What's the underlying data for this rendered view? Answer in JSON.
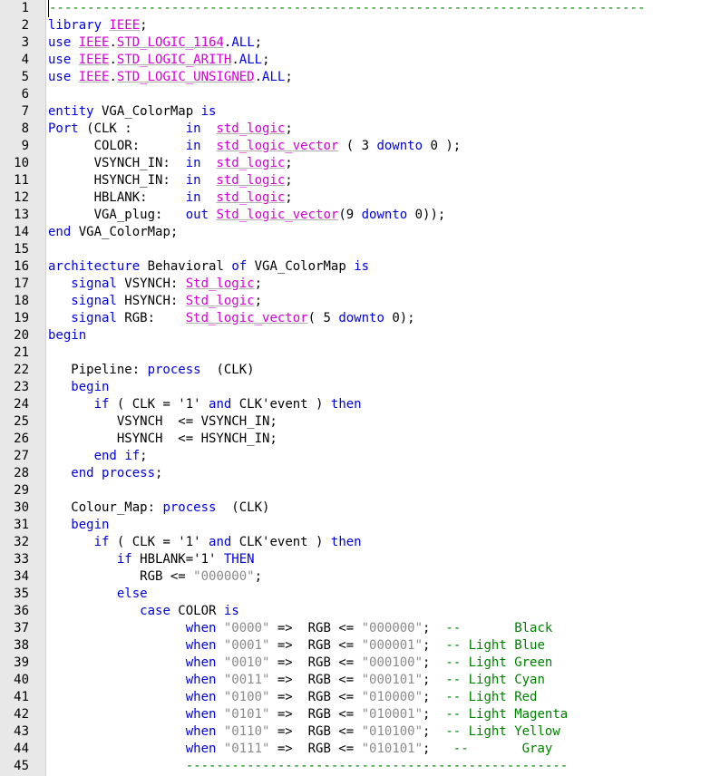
{
  "editor": {
    "colors": {
      "keyword": "#0000e6",
      "type": "#d400d4",
      "string": "#8a8a8a",
      "comment": "#008000",
      "gutter": "#e8e8e8"
    },
    "lines": [
      {
        "n": "1",
        "t": [
          [
            "cm",
            "------------------------------------------------------------------------------"
          ]
        ]
      },
      {
        "n": "2",
        "t": [
          [
            "kw",
            "library"
          ],
          [
            "id",
            " "
          ],
          [
            "typ",
            "IEEE"
          ],
          [
            "op",
            ";"
          ]
        ]
      },
      {
        "n": "3",
        "t": [
          [
            "kw",
            "use"
          ],
          [
            "id",
            " "
          ],
          [
            "typ",
            "IEEE"
          ],
          [
            "op",
            "."
          ],
          [
            "typ",
            "STD_LOGIC_1164"
          ],
          [
            "op",
            "."
          ],
          [
            "kw",
            "ALL"
          ],
          [
            "op",
            ";"
          ]
        ]
      },
      {
        "n": "4",
        "t": [
          [
            "kw",
            "use"
          ],
          [
            "id",
            " "
          ],
          [
            "typ",
            "IEEE"
          ],
          [
            "op",
            "."
          ],
          [
            "typ",
            "STD_LOGIC_ARITH"
          ],
          [
            "op",
            "."
          ],
          [
            "kw",
            "ALL"
          ],
          [
            "op",
            ";"
          ]
        ]
      },
      {
        "n": "5",
        "t": [
          [
            "kw",
            "use"
          ],
          [
            "id",
            " "
          ],
          [
            "typ",
            "IEEE"
          ],
          [
            "op",
            "."
          ],
          [
            "typ",
            "STD_LOGIC_UNSIGNED"
          ],
          [
            "op",
            "."
          ],
          [
            "kw",
            "ALL"
          ],
          [
            "op",
            ";"
          ]
        ]
      },
      {
        "n": "6",
        "t": []
      },
      {
        "n": "7",
        "t": [
          [
            "kw",
            "entity"
          ],
          [
            "id",
            " VGA_ColorMap "
          ],
          [
            "kw",
            "is"
          ]
        ]
      },
      {
        "n": "8",
        "t": [
          [
            "kw",
            "Port"
          ],
          [
            "id",
            " (CLK :       "
          ],
          [
            "kw",
            "in"
          ],
          [
            "id",
            "  "
          ],
          [
            "typ",
            "std_logic"
          ],
          [
            "op",
            ";"
          ]
        ]
      },
      {
        "n": "9",
        "t": [
          [
            "id",
            "      COLOR:      "
          ],
          [
            "kw",
            "in"
          ],
          [
            "id",
            "  "
          ],
          [
            "typ",
            "std_logic_vector"
          ],
          [
            "id",
            " ( 3 "
          ],
          [
            "kw",
            "downto"
          ],
          [
            "id",
            " 0 );"
          ]
        ]
      },
      {
        "n": "10",
        "t": [
          [
            "id",
            "      VSYNCH_IN:  "
          ],
          [
            "kw",
            "in"
          ],
          [
            "id",
            "  "
          ],
          [
            "typ",
            "std_logic"
          ],
          [
            "op",
            ";"
          ]
        ]
      },
      {
        "n": "11",
        "t": [
          [
            "id",
            "      HSYNCH_IN:  "
          ],
          [
            "kw",
            "in"
          ],
          [
            "id",
            "  "
          ],
          [
            "typ",
            "std_logic"
          ],
          [
            "op",
            ";"
          ]
        ]
      },
      {
        "n": "12",
        "t": [
          [
            "id",
            "      HBLANK:     "
          ],
          [
            "kw",
            "in"
          ],
          [
            "id",
            "  "
          ],
          [
            "typ",
            "std_logic"
          ],
          [
            "op",
            ";"
          ]
        ]
      },
      {
        "n": "13",
        "t": [
          [
            "id",
            "      VGA_plug:   "
          ],
          [
            "kw",
            "out"
          ],
          [
            "id",
            " "
          ],
          [
            "typ",
            "Std_logic_vector"
          ],
          [
            "id",
            "(9 "
          ],
          [
            "kw",
            "downto"
          ],
          [
            "id",
            " 0));"
          ]
        ]
      },
      {
        "n": "14",
        "t": [
          [
            "kw",
            "end"
          ],
          [
            "id",
            " VGA_ColorMap;"
          ]
        ]
      },
      {
        "n": "15",
        "t": []
      },
      {
        "n": "16",
        "t": [
          [
            "kw",
            "architecture"
          ],
          [
            "id",
            " Behavioral "
          ],
          [
            "kw",
            "of"
          ],
          [
            "id",
            " VGA_ColorMap "
          ],
          [
            "kw",
            "is"
          ]
        ]
      },
      {
        "n": "17",
        "t": [
          [
            "id",
            "   "
          ],
          [
            "kw",
            "signal"
          ],
          [
            "id",
            " VSYNCH: "
          ],
          [
            "typ",
            "Std_logic"
          ],
          [
            "op",
            ";"
          ]
        ]
      },
      {
        "n": "18",
        "t": [
          [
            "id",
            "   "
          ],
          [
            "kw",
            "signal"
          ],
          [
            "id",
            " HSYNCH: "
          ],
          [
            "typ",
            "Std_logic"
          ],
          [
            "op",
            ";"
          ]
        ]
      },
      {
        "n": "19",
        "t": [
          [
            "id",
            "   "
          ],
          [
            "kw",
            "signal"
          ],
          [
            "id",
            " RGB:    "
          ],
          [
            "typ",
            "Std_logic_vector"
          ],
          [
            "id",
            "( 5 "
          ],
          [
            "kw",
            "downto"
          ],
          [
            "id",
            " 0);"
          ]
        ]
      },
      {
        "n": "20",
        "t": [
          [
            "kw",
            "begin"
          ]
        ]
      },
      {
        "n": "21",
        "t": []
      },
      {
        "n": "22",
        "t": [
          [
            "id",
            "   Pipeline: "
          ],
          [
            "kw",
            "process"
          ],
          [
            "id",
            "  (CLK)"
          ]
        ]
      },
      {
        "n": "23",
        "t": [
          [
            "id",
            "   "
          ],
          [
            "kw",
            "begin"
          ]
        ]
      },
      {
        "n": "24",
        "t": [
          [
            "id",
            "      "
          ],
          [
            "kw",
            "if"
          ],
          [
            "id",
            " ( CLK = '1' "
          ],
          [
            "kw",
            "and"
          ],
          [
            "id",
            " CLK'event ) "
          ],
          [
            "kw",
            "then"
          ]
        ]
      },
      {
        "n": "25",
        "t": [
          [
            "id",
            "         VSYNCH  <= VSYNCH_IN;"
          ]
        ]
      },
      {
        "n": "26",
        "t": [
          [
            "id",
            "         HSYNCH  <= HSYNCH_IN;"
          ]
        ]
      },
      {
        "n": "27",
        "t": [
          [
            "id",
            "      "
          ],
          [
            "kw",
            "end"
          ],
          [
            "id",
            " "
          ],
          [
            "kw",
            "if"
          ],
          [
            "op",
            ";"
          ]
        ]
      },
      {
        "n": "28",
        "t": [
          [
            "id",
            "   "
          ],
          [
            "kw",
            "end"
          ],
          [
            "id",
            " "
          ],
          [
            "kw",
            "process"
          ],
          [
            "op",
            ";"
          ]
        ]
      },
      {
        "n": "29",
        "t": []
      },
      {
        "n": "30",
        "t": [
          [
            "id",
            "   Colour_Map: "
          ],
          [
            "kw",
            "process"
          ],
          [
            "id",
            "  (CLK)"
          ]
        ]
      },
      {
        "n": "31",
        "t": [
          [
            "id",
            "   "
          ],
          [
            "kw",
            "begin"
          ]
        ]
      },
      {
        "n": "32",
        "t": [
          [
            "id",
            "      "
          ],
          [
            "kw",
            "if"
          ],
          [
            "id",
            " ( CLK = '1' "
          ],
          [
            "kw",
            "and"
          ],
          [
            "id",
            " CLK'event ) "
          ],
          [
            "kw",
            "then"
          ]
        ]
      },
      {
        "n": "33",
        "t": [
          [
            "id",
            "         "
          ],
          [
            "kw",
            "if"
          ],
          [
            "id",
            " HBLANK='1' "
          ],
          [
            "kw",
            "THEN"
          ]
        ]
      },
      {
        "n": "34",
        "t": [
          [
            "id",
            "            RGB <= "
          ],
          [
            "str",
            "\"000000\""
          ],
          [
            "op",
            ";"
          ]
        ]
      },
      {
        "n": "35",
        "t": [
          [
            "id",
            "         "
          ],
          [
            "kw",
            "else"
          ]
        ]
      },
      {
        "n": "36",
        "t": [
          [
            "id",
            "            "
          ],
          [
            "kw",
            "case"
          ],
          [
            "id",
            " COLOR "
          ],
          [
            "kw",
            "is"
          ]
        ]
      },
      {
        "n": "37",
        "t": [
          [
            "id",
            "                  "
          ],
          [
            "kw",
            "when"
          ],
          [
            "id",
            " "
          ],
          [
            "str",
            "\"0000\""
          ],
          [
            "id",
            " =>  RGB <= "
          ],
          [
            "str",
            "\"000000\""
          ],
          [
            "id",
            ";  "
          ],
          [
            "cm",
            "--       Black"
          ]
        ]
      },
      {
        "n": "38",
        "t": [
          [
            "id",
            "                  "
          ],
          [
            "kw",
            "when"
          ],
          [
            "id",
            " "
          ],
          [
            "str",
            "\"0001\""
          ],
          [
            "id",
            " =>  RGB <= "
          ],
          [
            "str",
            "\"000001\""
          ],
          [
            "id",
            ";  "
          ],
          [
            "cm",
            "-- Light Blue"
          ]
        ]
      },
      {
        "n": "39",
        "t": [
          [
            "id",
            "                  "
          ],
          [
            "kw",
            "when"
          ],
          [
            "id",
            " "
          ],
          [
            "str",
            "\"0010\""
          ],
          [
            "id",
            " =>  RGB <= "
          ],
          [
            "str",
            "\"000100\""
          ],
          [
            "id",
            ";  "
          ],
          [
            "cm",
            "-- Light Green"
          ]
        ]
      },
      {
        "n": "40",
        "t": [
          [
            "id",
            "                  "
          ],
          [
            "kw",
            "when"
          ],
          [
            "id",
            " "
          ],
          [
            "str",
            "\"0011\""
          ],
          [
            "id",
            " =>  RGB <= "
          ],
          [
            "str",
            "\"000101\""
          ],
          [
            "id",
            ";  "
          ],
          [
            "cm",
            "-- Light Cyan"
          ]
        ]
      },
      {
        "n": "41",
        "t": [
          [
            "id",
            "                  "
          ],
          [
            "kw",
            "when"
          ],
          [
            "id",
            " "
          ],
          [
            "str",
            "\"0100\""
          ],
          [
            "id",
            " =>  RGB <= "
          ],
          [
            "str",
            "\"010000\""
          ],
          [
            "id",
            ";  "
          ],
          [
            "cm",
            "-- Light Red"
          ]
        ]
      },
      {
        "n": "42",
        "t": [
          [
            "id",
            "                  "
          ],
          [
            "kw",
            "when"
          ],
          [
            "id",
            " "
          ],
          [
            "str",
            "\"0101\""
          ],
          [
            "id",
            " =>  RGB <= "
          ],
          [
            "str",
            "\"010001\""
          ],
          [
            "id",
            ";  "
          ],
          [
            "cm",
            "-- Light Magenta"
          ]
        ]
      },
      {
        "n": "43",
        "t": [
          [
            "id",
            "                  "
          ],
          [
            "kw",
            "when"
          ],
          [
            "id",
            " "
          ],
          [
            "str",
            "\"0110\""
          ],
          [
            "id",
            " =>  RGB <= "
          ],
          [
            "str",
            "\"010100\""
          ],
          [
            "id",
            ";  "
          ],
          [
            "cm",
            "-- Light Yellow"
          ]
        ]
      },
      {
        "n": "44",
        "t": [
          [
            "id",
            "                  "
          ],
          [
            "kw",
            "when"
          ],
          [
            "id",
            " "
          ],
          [
            "str",
            "\"0111\""
          ],
          [
            "id",
            " =>  RGB <= "
          ],
          [
            "str",
            "\"010101\""
          ],
          [
            "id",
            ";   "
          ],
          [
            "cm",
            "--       Gray"
          ]
        ]
      },
      {
        "n": "45",
        "t": [
          [
            "id",
            "                  "
          ],
          [
            "cm",
            "--------------------------------------------------"
          ]
        ]
      }
    ]
  }
}
